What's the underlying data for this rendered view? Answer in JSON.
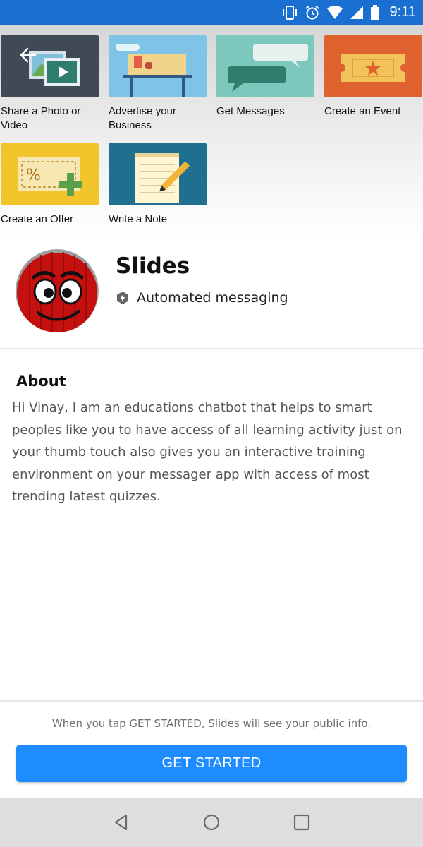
{
  "status_bar": {
    "time": "9:11"
  },
  "cover": {
    "tiles": [
      {
        "label": "Share a Photo or Video",
        "icon": "photo-video-icon"
      },
      {
        "label": "Advertise your Business",
        "icon": "storefront-icon"
      },
      {
        "label": "Get Messages",
        "icon": "chat-bubbles-icon"
      },
      {
        "label": "Create an Event",
        "icon": "ticket-icon"
      },
      {
        "label": "Create an Offer",
        "icon": "coupon-icon"
      },
      {
        "label": "Write a Note",
        "icon": "notepad-pencil-icon"
      }
    ]
  },
  "profile": {
    "title": "Slides",
    "badge": "Automated messaging"
  },
  "about": {
    "heading": "About",
    "body": "Hi Vinay, I am an educations chatbot that helps to smart peoples like you to have access of all learning activity just on your thumb touch also gives you an interactive training environment on your messager app with access of most trending latest quizzes."
  },
  "footer": {
    "note": "When you tap GET STARTED, Slides will see your public info.",
    "cta_label": "GET STARTED"
  },
  "colors": {
    "status_bar": "#1a6fd0",
    "cta": "#1e8cff",
    "nav_bar": "#dedede"
  }
}
